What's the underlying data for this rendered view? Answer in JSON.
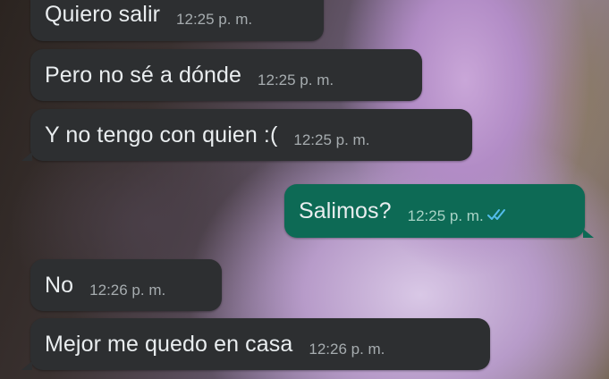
{
  "messages": [
    {
      "direction": "incoming",
      "text": "Quiero salir",
      "time": "12:25 p. m."
    },
    {
      "direction": "incoming",
      "text": "Pero no sé a dónde",
      "time": "12:25 p. m."
    },
    {
      "direction": "incoming",
      "text": "Y no tengo con quien :(",
      "time": "12:25 p. m."
    },
    {
      "direction": "outgoing",
      "text": "Salimos?",
      "time": "12:25 p. m.",
      "status_icon": "double-check-icon",
      "status": "read"
    },
    {
      "direction": "incoming",
      "text": "No",
      "time": "12:26 p. m."
    },
    {
      "direction": "incoming",
      "text": "Mejor me quedo en casa",
      "time": "12:26 p. m."
    }
  ],
  "colors": {
    "incoming_bubble": "#2d2f31",
    "outgoing_bubble": "#0d6a55",
    "read_ticks": "#53bdeb"
  }
}
